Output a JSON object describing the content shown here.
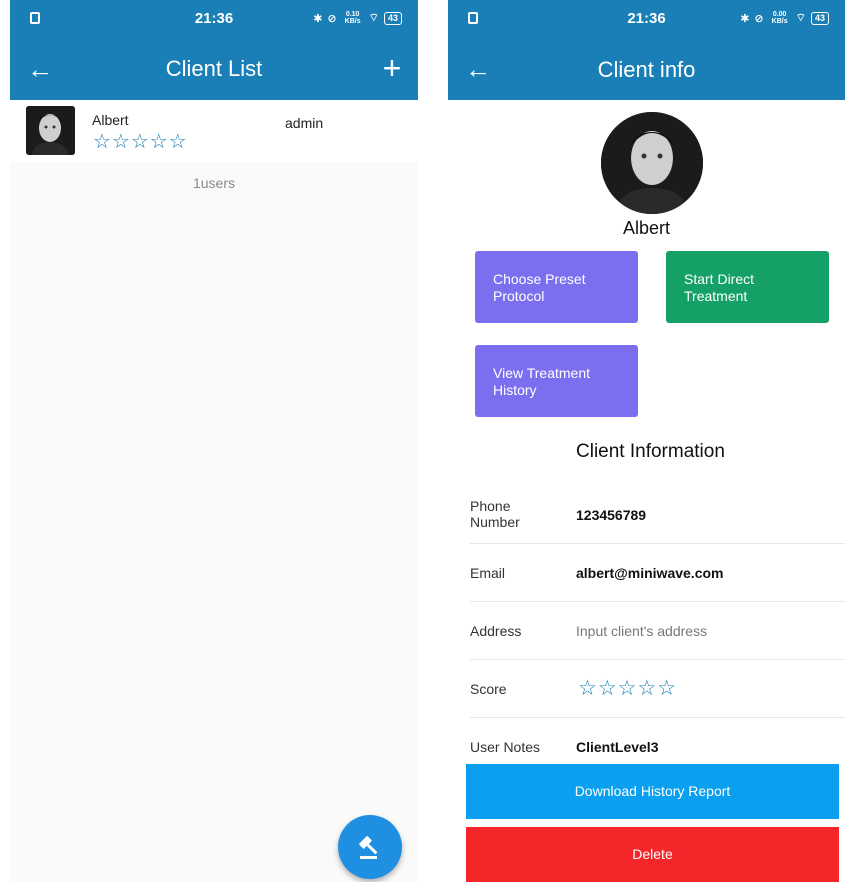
{
  "status": {
    "time": "21:36",
    "battery": "43",
    "speed_left": "0.10 KB/s",
    "speed_right": "0.00 KB/s"
  },
  "left": {
    "title": "Client List",
    "client": {
      "name": "Albert",
      "role": "admin",
      "stars": "☆☆☆☆☆"
    },
    "count": "1users",
    "fab_icon": "gavel-icon"
  },
  "right": {
    "title": "Client info",
    "name": "Albert",
    "buttons": {
      "preset": "Choose Preset Protocol",
      "direct": "Start Direct Treatment",
      "history": "View Treatment History"
    },
    "section_title": "Client Information",
    "fields": {
      "phone_label": "Phone Number",
      "phone_value": "123456789",
      "email_label": "Email",
      "email_value": "albert@miniwave.com",
      "address_label": "Address",
      "address_placeholder": "Input client's address",
      "score_label": "Score",
      "score_stars": "☆☆☆☆☆",
      "notes_label": "User Notes",
      "notes_value": "ClientLevel3"
    },
    "download_label": "Download History Report",
    "delete_label": "Delete"
  },
  "colors": {
    "appbar": "#1a7fb6",
    "purple": "#7b6fef",
    "green": "#15a066",
    "download": "#0aa0ef",
    "delete": "#f4262a",
    "fab": "#1e8fe1"
  }
}
